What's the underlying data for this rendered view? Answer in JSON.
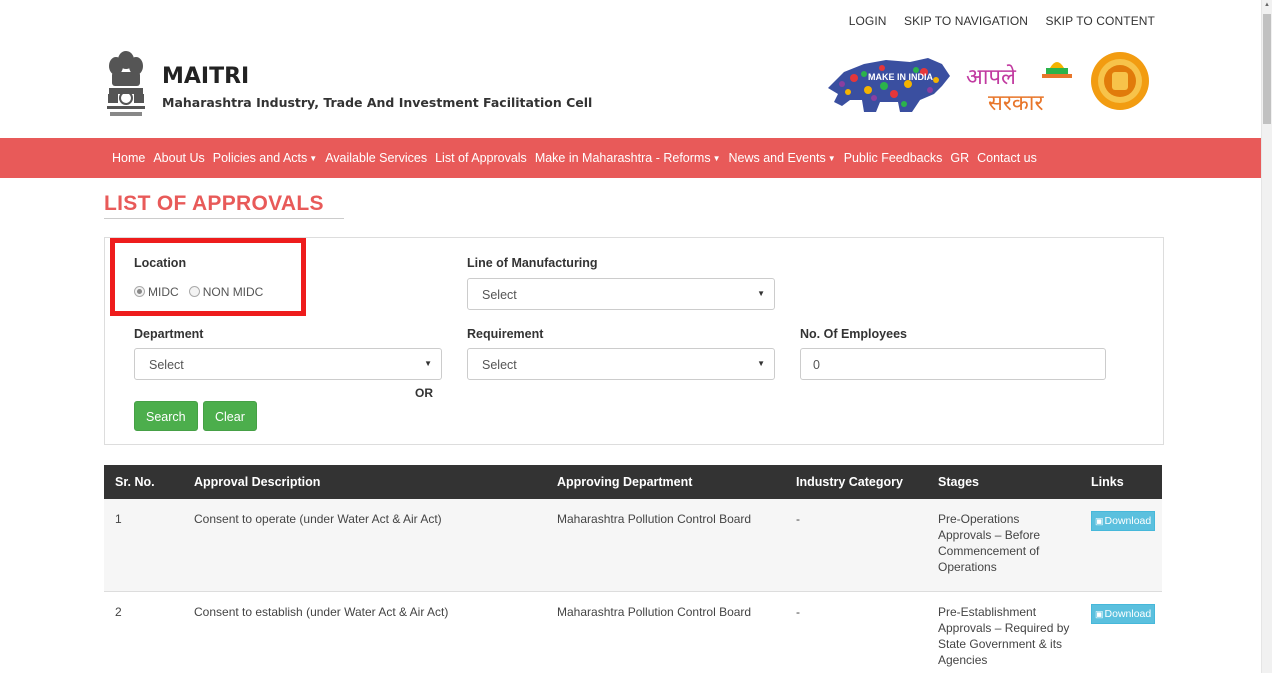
{
  "top_links": [
    "LOGIN",
    "SKIP TO NAVIGATION",
    "SKIP TO CONTENT"
  ],
  "header": {
    "title": "MAITRI",
    "subtitle": "Maharashtra Industry, Trade And Investment Facilitation Cell",
    "logo_makeinindia": "MAKE IN INDIA",
    "logo_aaple_line1": "आपले",
    "logo_aaple_line2": "सरकार"
  },
  "nav": [
    {
      "label": "Home",
      "dropdown": false
    },
    {
      "label": "About Us",
      "dropdown": false
    },
    {
      "label": "Policies and Acts",
      "dropdown": true
    },
    {
      "label": "Available Services",
      "dropdown": false
    },
    {
      "label": "List of Approvals",
      "dropdown": false
    },
    {
      "label": "Make in Maharashtra - Reforms",
      "dropdown": true
    },
    {
      "label": "News and Events",
      "dropdown": true
    },
    {
      "label": "Public Feedbacks",
      "dropdown": false
    },
    {
      "label": "GR",
      "dropdown": false
    },
    {
      "label": "Contact us",
      "dropdown": false
    }
  ],
  "page_title": "LIST OF APPROVALS",
  "filters": {
    "location_label": "Location",
    "location_options": [
      "MIDC",
      "NON MIDC"
    ],
    "location_selected": "MIDC",
    "line_label": "Line of Manufacturing",
    "line_value": "Select",
    "department_label": "Department",
    "department_value": "Select",
    "requirement_label": "Requirement",
    "requirement_value": "Select",
    "employees_label": "No. Of Employees",
    "employees_value": "0",
    "or_text": "OR",
    "search_button": "Search",
    "clear_button": "Clear"
  },
  "table": {
    "headers": [
      "Sr. No.",
      "Approval Description",
      "Approving Department",
      "Industry Category",
      "Stages",
      "Links"
    ],
    "rows": [
      {
        "sr": "1",
        "description": "Consent to operate (under Water Act & Air Act)",
        "department": "Maharashtra Pollution Control Board",
        "category": "-",
        "stages": "Pre-Operations Approvals – Before Commencement of Operations",
        "link": "Download"
      },
      {
        "sr": "2",
        "description": "Consent to establish (under Water Act & Air Act)",
        "department": "Maharashtra Pollution Control Board",
        "category": "-",
        "stages": "Pre-Establishment Approvals – Required by State Government & its Agencies",
        "link": "Download"
      }
    ]
  },
  "colors": {
    "nav_bg": "#e85a59",
    "title_color": "#e85a59",
    "button_green": "#4cae4c",
    "table_header_bg": "#333333",
    "download_blue": "#5bc0de",
    "highlight_red": "#ee1c1c"
  }
}
